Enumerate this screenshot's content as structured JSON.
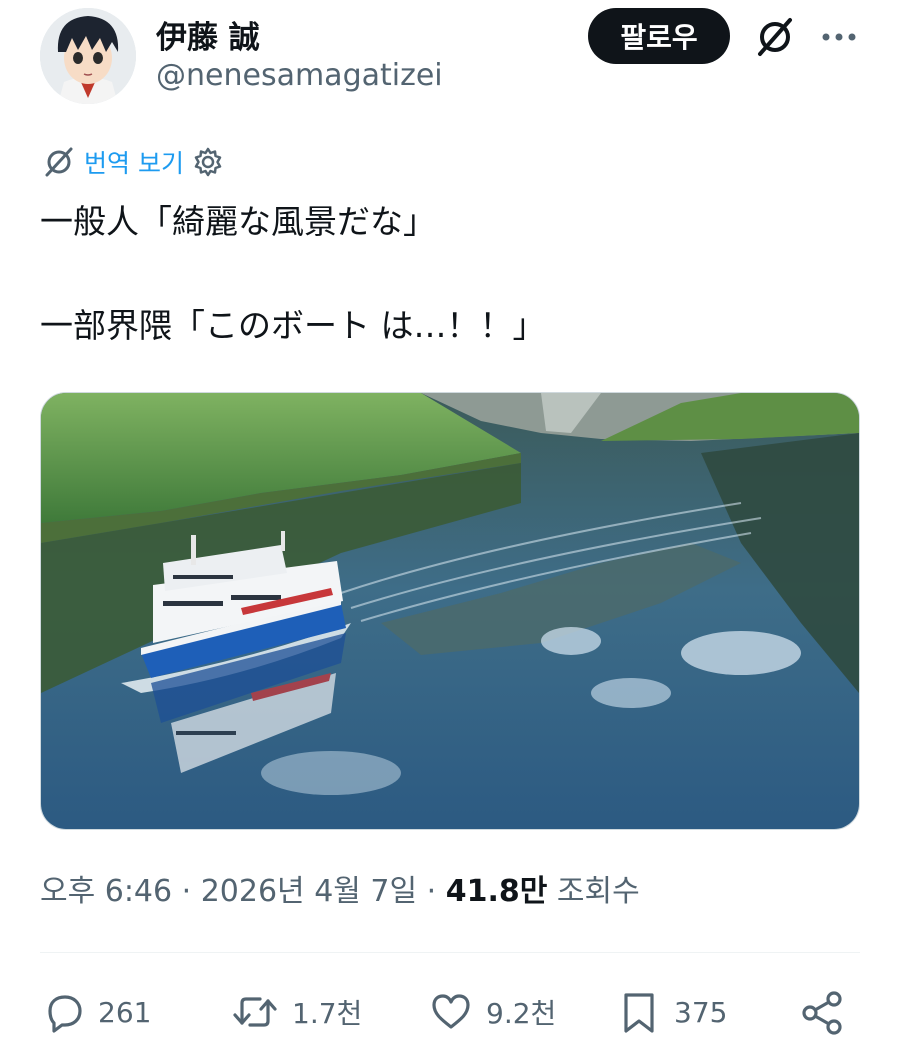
{
  "author": {
    "name": "伊藤 誠",
    "handle": "@nenesamagatizei",
    "avatar_icon": "anime-avatar"
  },
  "header": {
    "follow_label": "팔로우",
    "grok_icon": "grok-icon",
    "more_icon": "more-icon"
  },
  "translate": {
    "label": "번역 보기",
    "icon": "grok-translate-icon",
    "settings_icon": "gear-icon"
  },
  "tweet": {
    "text": "一般人「綺麗な風景だな」\n\n一部界隈「このボート は…！！」"
  },
  "meta": {
    "time": "오후 6:46 · 2026년 4월 7일 · ",
    "views_count": "41.8만",
    "views_label": " 조회수"
  },
  "actions": {
    "reply_count": "261",
    "repost_count": "1.7천",
    "like_count": "9.2천",
    "bookmark_count": "375"
  },
  "colors": {
    "accent": "#1d9bf0",
    "text": "#0f1419",
    "secondary": "#536471"
  }
}
